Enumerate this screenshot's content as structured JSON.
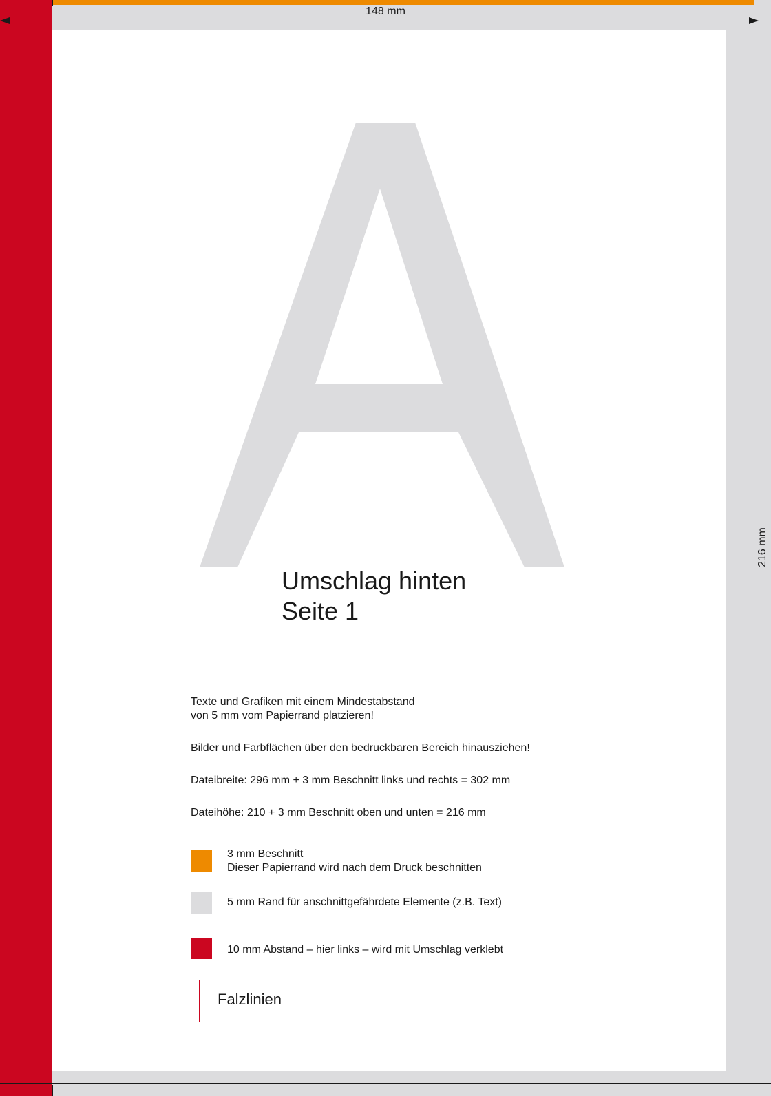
{
  "dimensions": {
    "width_label": "148 mm",
    "height_label": "216 mm"
  },
  "cover": {
    "letter": "A",
    "title": "Umschlag hinten",
    "page": "Seite 1"
  },
  "instructions": {
    "margin_line_1": "Texte und Grafiken mit einem Mindestabstand",
    "margin_line_2": "von 5 mm vom Papierrand platzieren!",
    "bleed_images": "Bilder und Farbflächen über den bedruckbaren Bereich hinausziehen!",
    "file_width": "Dateibreite: 296 mm + 3 mm Beschnitt links und rechts = 302 mm",
    "file_height": "Dateihöhe: 210 + 3 mm Beschnitt oben und unten = 216 mm"
  },
  "legend": {
    "bleed": {
      "title": "3 mm Beschnitt",
      "description": "Dieser Papierrand wird nach dem Druck beschnitten",
      "color": "#ee8a00"
    },
    "safe_margin": {
      "text": "5 mm Rand für anschnittgefährdete Elemente (z.B. Text)",
      "color": "#dcdcde"
    },
    "glue_gap": {
      "text": "10 mm Abstand – hier links – wird mit Umschlag verklebt",
      "color": "#cb0620"
    },
    "fold_lines": {
      "text": "Falzlinien",
      "color": "#cb0620"
    }
  },
  "colors": {
    "letter_grey": "#dcdcde",
    "background": "#ffffff"
  }
}
